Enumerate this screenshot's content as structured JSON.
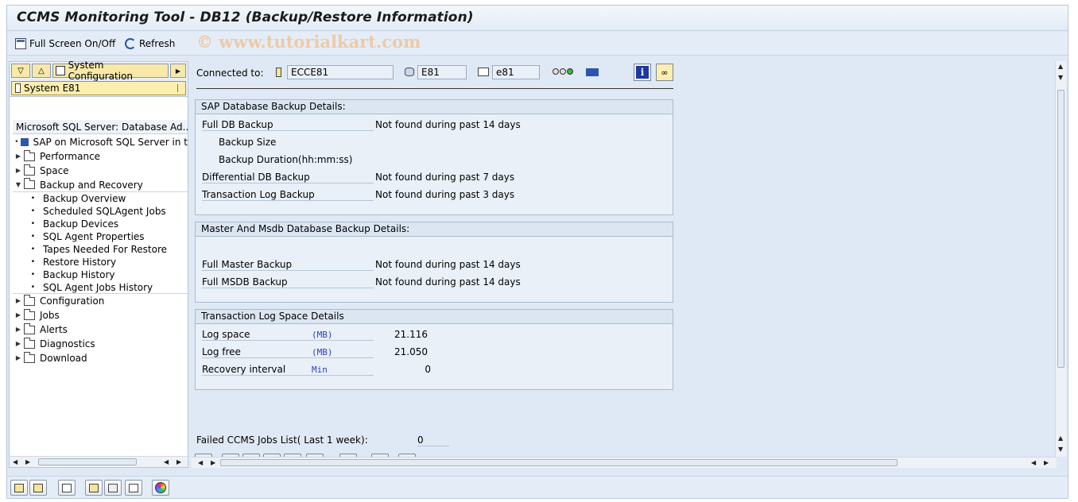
{
  "window": {
    "title": "CCMS Monitoring Tool - DB12 (Backup/Restore Information)"
  },
  "toolbar": {
    "fullscreen_label": "Full Screen On/Off",
    "refresh_label": "Refresh",
    "watermark": "© www.tutorialkart.com"
  },
  "left_panel": {
    "system_config_label": "System Configuration",
    "system_field": "System E81",
    "tree_header": "Microsoft SQL Server: Database Ad...",
    "tree": {
      "root_item": "SAP on Microsoft SQL Server in t",
      "performance": "Performance",
      "space": "Space",
      "backup_recovery": "Backup and Recovery",
      "backup_children": [
        "Backup Overview",
        "Scheduled SQLAgent Jobs",
        "Backup Devices",
        "SQL Agent Properties",
        "Tapes Needed For Restore",
        "Restore History",
        "Backup History",
        "SQL Agent Jobs History"
      ],
      "configuration": "Configuration",
      "jobs": "Jobs",
      "alerts": "Alerts",
      "diagnostics": "Diagnostics",
      "download": "Download"
    }
  },
  "connection": {
    "label": "Connected to:",
    "host": "ECCE81",
    "db": "E81",
    "schema": "e81"
  },
  "sap_backup": {
    "title": "SAP Database Backup Details:",
    "full_db_label": "Full DB Backup",
    "full_db_value": "Not found during past 14 days",
    "backup_size_label": "Backup Size",
    "backup_duration_label": "Backup Duration(hh:mm:ss)",
    "diff_label": "Differential DB Backup",
    "diff_value": "Not found during past 7 days",
    "tlog_label": "Transaction Log Backup",
    "tlog_value": "Not found during past 3 days"
  },
  "master_backup": {
    "title": "Master And Msdb Database Backup Details:",
    "master_label": "Full Master Backup",
    "master_value": "Not found during past 14 days",
    "msdb_label": "Full MSDB Backup",
    "msdb_value": "Not found during past 14 days"
  },
  "tlog_space": {
    "title": "Transaction Log Space Details",
    "log_space_label": "Log space",
    "log_space_unit": "(MB)",
    "log_space_value": "21.116",
    "log_free_label": "Log free",
    "log_free_unit": "(MB)",
    "log_free_value": "21.050",
    "recovery_label": "Recovery interval",
    "recovery_unit": "Min",
    "recovery_value": "0"
  },
  "failed_jobs": {
    "label": "Failed CCMS Jobs List( Last 1 week):",
    "value": "0"
  },
  "colors": {
    "background": "#dfe9f5",
    "accent_unit": "#2b3fc8",
    "yellow_field": "#fbeeb0"
  }
}
